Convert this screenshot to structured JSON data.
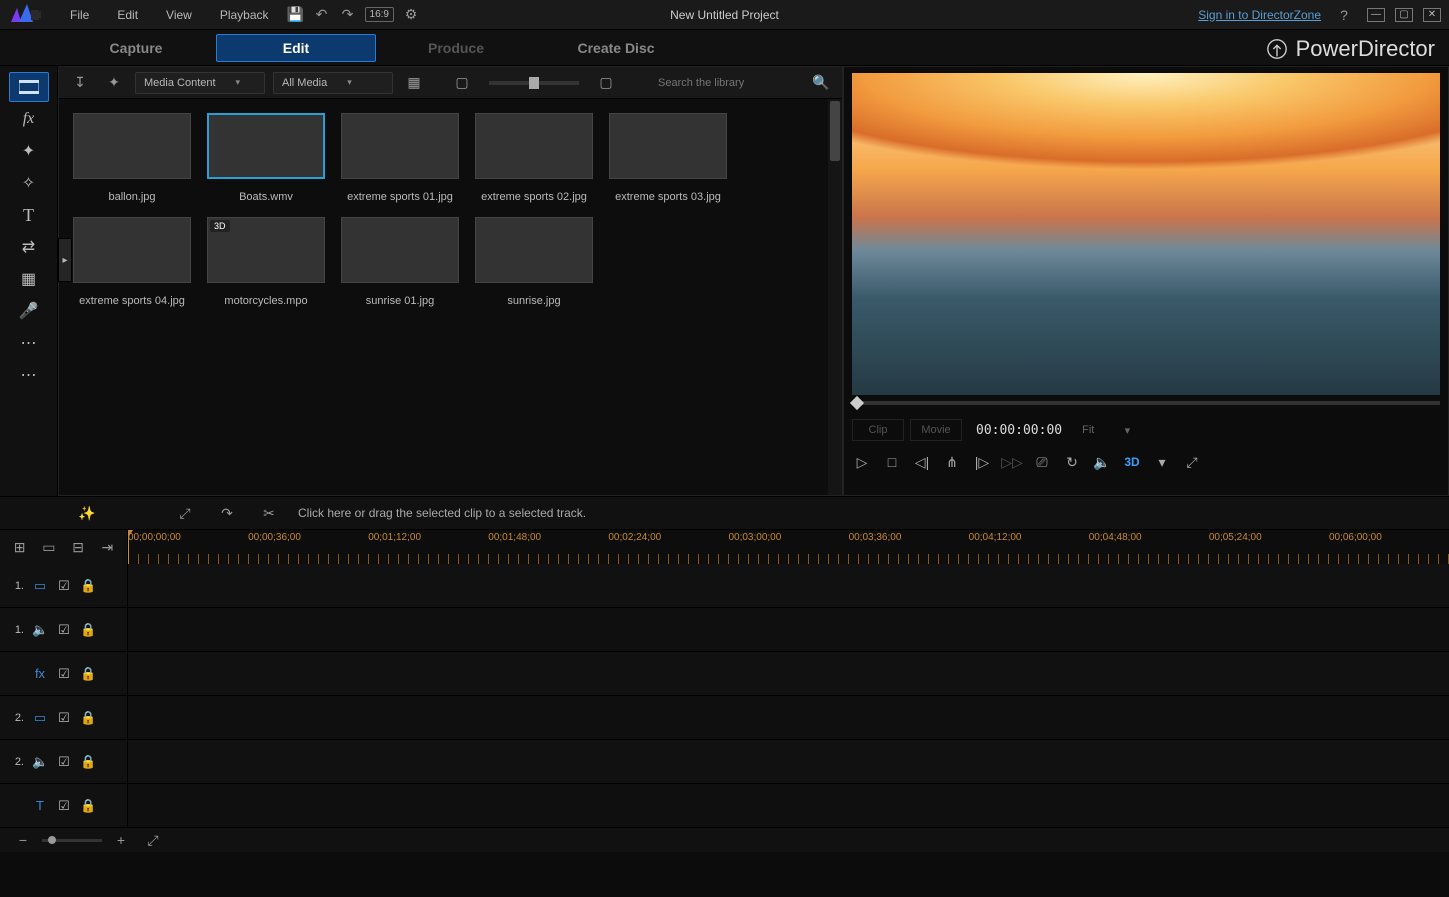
{
  "app": {
    "name": "PowerDirector",
    "project_title": "New Untitled Project"
  },
  "top_link": "Sign in to DirectorZone",
  "menu": [
    "File",
    "Edit",
    "View",
    "Playback"
  ],
  "aspect_badge": "16:9",
  "tabs": {
    "items": [
      "Capture",
      "Edit",
      "Produce",
      "Create Disc"
    ],
    "active": 1,
    "disabled": 2
  },
  "library": {
    "dropdown1": "Media Content",
    "dropdown2": "All Media",
    "search_placeholder": "Search the library",
    "selected": 1,
    "items": [
      {
        "label": "ballon.jpg",
        "art": "art-balloons"
      },
      {
        "label": "Boats.wmv",
        "art": "art-boats"
      },
      {
        "label": "extreme sports 01.jpg",
        "art": "art-sport1"
      },
      {
        "label": "extreme sports 02.jpg",
        "art": "art-sport2"
      },
      {
        "label": "extreme sports 03.jpg",
        "art": "art-sport3"
      },
      {
        "label": "extreme sports 04.jpg",
        "art": "art-sport4"
      },
      {
        "label": "motorcycles.mpo",
        "art": "art-moto",
        "badge": "3D"
      },
      {
        "label": "sunrise 01.jpg",
        "art": "art-sunrise1"
      },
      {
        "label": "sunrise.jpg",
        "art": "art-sunrise2"
      }
    ]
  },
  "preview": {
    "clip_label": "Clip",
    "movie_label": "Movie",
    "timecode": "00:00:00:00",
    "fit_label": "Fit",
    "threeD": "3D"
  },
  "actionbar": {
    "hint": "Click here or drag the selected clip to a selected track."
  },
  "timeline": {
    "ruler": [
      "00;00;00;00",
      "00;00;36;00",
      "00;01;12;00",
      "00;01;48;00",
      "00;02;24;00",
      "00;03;00;00",
      "00;03;36;00",
      "00;04;12;00",
      "00;04;48;00",
      "00;05;24;00",
      "00;06;00;00"
    ],
    "tracks": [
      {
        "number": "1.",
        "icon": "film",
        "lock": true
      },
      {
        "number": "1.",
        "icon": "audio",
        "lock": true
      },
      {
        "number": "",
        "icon": "fx",
        "lock": true
      },
      {
        "number": "2.",
        "icon": "film",
        "lock": true
      },
      {
        "number": "2.",
        "icon": "audio",
        "lock": true
      },
      {
        "number": "",
        "icon": "title",
        "lock": true
      }
    ]
  }
}
